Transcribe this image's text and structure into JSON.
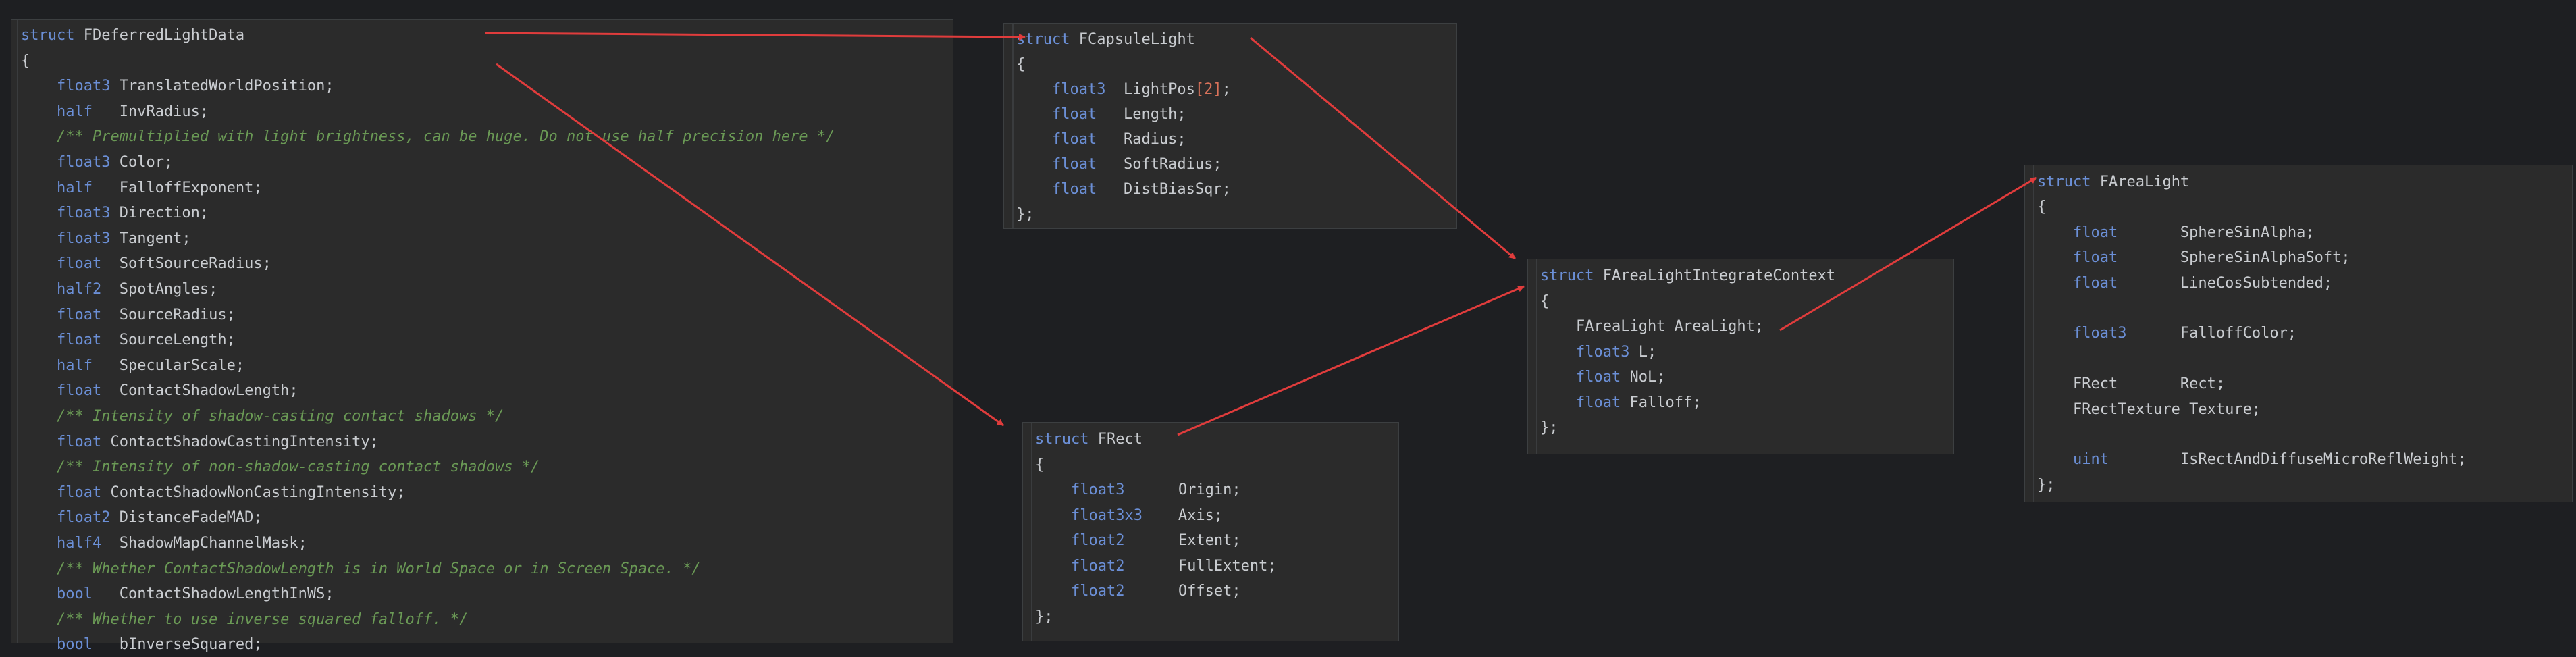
{
  "panels": [
    {
      "id": "deferred",
      "lines": [
        [
          [
            "kw",
            "struct"
          ],
          [
            "tx",
            " FDeferredLightData"
          ]
        ],
        [
          [
            "tx",
            "{"
          ]
        ],
        [
          [
            "tx",
            "    "
          ],
          [
            "kw",
            "float3"
          ],
          [
            "tx",
            " TranslatedWorldPosition;"
          ]
        ],
        [
          [
            "tx",
            "    "
          ],
          [
            "kw",
            "half"
          ],
          [
            "tx",
            "   InvRadius;"
          ]
        ],
        [
          [
            "tx",
            "    "
          ],
          [
            "cm",
            "/** Premultiplied with light brightness, can be huge. Do not use half precision here */"
          ]
        ],
        [
          [
            "tx",
            "    "
          ],
          [
            "kw",
            "float3"
          ],
          [
            "tx",
            " Color;"
          ]
        ],
        [
          [
            "tx",
            "    "
          ],
          [
            "kw",
            "half"
          ],
          [
            "tx",
            "   FalloffExponent;"
          ]
        ],
        [
          [
            "tx",
            "    "
          ],
          [
            "kw",
            "float3"
          ],
          [
            "tx",
            " Direction;"
          ]
        ],
        [
          [
            "tx",
            "    "
          ],
          [
            "kw",
            "float3"
          ],
          [
            "tx",
            " Tangent;"
          ]
        ],
        [
          [
            "tx",
            "    "
          ],
          [
            "kw",
            "float"
          ],
          [
            "tx",
            "  SoftSourceRadius;"
          ]
        ],
        [
          [
            "tx",
            "    "
          ],
          [
            "kw",
            "half2"
          ],
          [
            "tx",
            "  SpotAngles;"
          ]
        ],
        [
          [
            "tx",
            "    "
          ],
          [
            "kw",
            "float"
          ],
          [
            "tx",
            "  SourceRadius;"
          ]
        ],
        [
          [
            "tx",
            "    "
          ],
          [
            "kw",
            "float"
          ],
          [
            "tx",
            "  SourceLength;"
          ]
        ],
        [
          [
            "tx",
            "    "
          ],
          [
            "kw",
            "half"
          ],
          [
            "tx",
            "   SpecularScale;"
          ]
        ],
        [
          [
            "tx",
            "    "
          ],
          [
            "kw",
            "float"
          ],
          [
            "tx",
            "  ContactShadowLength;"
          ]
        ],
        [
          [
            "tx",
            "    "
          ],
          [
            "cm",
            "/** Intensity of shadow-casting contact shadows */"
          ]
        ],
        [
          [
            "tx",
            "    "
          ],
          [
            "kw",
            "float"
          ],
          [
            "tx",
            " ContactShadowCastingIntensity;"
          ]
        ],
        [
          [
            "tx",
            "    "
          ],
          [
            "cm",
            "/** Intensity of non-shadow-casting contact shadows */"
          ]
        ],
        [
          [
            "tx",
            "    "
          ],
          [
            "kw",
            "float"
          ],
          [
            "tx",
            " ContactShadowNonCastingIntensity;"
          ]
        ],
        [
          [
            "tx",
            "    "
          ],
          [
            "kw",
            "float2"
          ],
          [
            "tx",
            " DistanceFadeMAD;"
          ]
        ],
        [
          [
            "tx",
            "    "
          ],
          [
            "kw",
            "half4"
          ],
          [
            "tx",
            "  ShadowMapChannelMask;"
          ]
        ],
        [
          [
            "tx",
            "    "
          ],
          [
            "cm",
            "/** Whether ContactShadowLength is in World Space or in Screen Space. */"
          ]
        ],
        [
          [
            "tx",
            "    "
          ],
          [
            "kw",
            "bool"
          ],
          [
            "tx",
            "   ContactShadowLengthInWS;"
          ]
        ],
        [
          [
            "tx",
            "    "
          ],
          [
            "cm",
            "/** Whether to use inverse squared falloff. */"
          ]
        ],
        [
          [
            "tx",
            "    "
          ],
          [
            "kw",
            "bool"
          ],
          [
            "tx",
            "   bInverseSquared;"
          ]
        ]
      ]
    },
    {
      "id": "capsule",
      "lines": [
        [
          [
            "kw",
            "struct"
          ],
          [
            "tx",
            " FCapsuleLight"
          ]
        ],
        [
          [
            "tx",
            "{"
          ]
        ],
        [
          [
            "tx",
            "    "
          ],
          [
            "kw",
            "float3"
          ],
          [
            "tx",
            "  LightPos"
          ],
          [
            "num",
            "[2]"
          ],
          [
            "tx",
            ";"
          ]
        ],
        [
          [
            "tx",
            "    "
          ],
          [
            "kw",
            "float"
          ],
          [
            "tx",
            "   Length;"
          ]
        ],
        [
          [
            "tx",
            "    "
          ],
          [
            "kw",
            "float"
          ],
          [
            "tx",
            "   Radius;"
          ]
        ],
        [
          [
            "tx",
            "    "
          ],
          [
            "kw",
            "float"
          ],
          [
            "tx",
            "   SoftRadius;"
          ]
        ],
        [
          [
            "tx",
            "    "
          ],
          [
            "kw",
            "float"
          ],
          [
            "tx",
            "   DistBiasSqr;"
          ]
        ],
        [
          [
            "tx",
            "};"
          ]
        ]
      ]
    },
    {
      "id": "rect",
      "lines": [
        [
          [
            "kw",
            "struct"
          ],
          [
            "tx",
            " FRect"
          ]
        ],
        [
          [
            "tx",
            "{"
          ]
        ],
        [
          [
            "tx",
            "    "
          ],
          [
            "kw",
            "float3"
          ],
          [
            "tx",
            "      Origin;"
          ]
        ],
        [
          [
            "tx",
            "    "
          ],
          [
            "kw",
            "float3x3"
          ],
          [
            "tx",
            "    Axis;"
          ]
        ],
        [
          [
            "tx",
            "    "
          ],
          [
            "kw",
            "float2"
          ],
          [
            "tx",
            "      Extent;"
          ]
        ],
        [
          [
            "tx",
            "    "
          ],
          [
            "kw",
            "float2"
          ],
          [
            "tx",
            "      FullExtent;"
          ]
        ],
        [
          [
            "tx",
            "    "
          ],
          [
            "kw",
            "float2"
          ],
          [
            "tx",
            "      Offset;"
          ]
        ],
        [
          [
            "tx",
            "};"
          ]
        ]
      ]
    },
    {
      "id": "integrate",
      "lines": [
        [
          [
            "kw",
            "struct"
          ],
          [
            "tx",
            " FAreaLightIntegrateContext"
          ]
        ],
        [
          [
            "tx",
            "{"
          ]
        ],
        [
          [
            "tx",
            "    FAreaLight AreaLight;"
          ]
        ],
        [
          [
            "tx",
            "    "
          ],
          [
            "kw",
            "float3"
          ],
          [
            "tx",
            " L;"
          ]
        ],
        [
          [
            "tx",
            "    "
          ],
          [
            "kw",
            "float"
          ],
          [
            "tx",
            " NoL;"
          ]
        ],
        [
          [
            "tx",
            "    "
          ],
          [
            "kw",
            "float"
          ],
          [
            "tx",
            " Falloff;"
          ]
        ],
        [
          [
            "tx",
            "};"
          ]
        ]
      ]
    },
    {
      "id": "arealight",
      "lines": [
        [
          [
            "kw",
            "struct"
          ],
          [
            "tx",
            " FAreaLight"
          ]
        ],
        [
          [
            "tx",
            "{"
          ]
        ],
        [
          [
            "tx",
            "    "
          ],
          [
            "kw",
            "float"
          ],
          [
            "tx",
            "       SphereSinAlpha;"
          ]
        ],
        [
          [
            "tx",
            "    "
          ],
          [
            "kw",
            "float"
          ],
          [
            "tx",
            "       SphereSinAlphaSoft;"
          ]
        ],
        [
          [
            "tx",
            "    "
          ],
          [
            "kw",
            "float"
          ],
          [
            "tx",
            "       LineCosSubtended;"
          ]
        ],
        [
          [
            "tx",
            ""
          ]
        ],
        [
          [
            "tx",
            "    "
          ],
          [
            "kw",
            "float3"
          ],
          [
            "tx",
            "      FalloffColor;"
          ]
        ],
        [
          [
            "tx",
            ""
          ]
        ],
        [
          [
            "tx",
            "    FRect       Rect;"
          ]
        ],
        [
          [
            "tx",
            "    FRectTexture Texture;"
          ]
        ],
        [
          [
            "tx",
            ""
          ]
        ],
        [
          [
            "tx",
            "    "
          ],
          [
            "kw",
            "uint"
          ],
          [
            "tx",
            "        IsRectAndDiffuseMicroReflWeight;"
          ]
        ],
        [
          [
            "tx",
            "};"
          ]
        ]
      ]
    }
  ],
  "colors": {
    "arrow": "#e03c3c",
    "keyword": "#6b8fd6",
    "text": "#c9ccd0",
    "comment": "#6a9955",
    "number": "#d9725a"
  }
}
